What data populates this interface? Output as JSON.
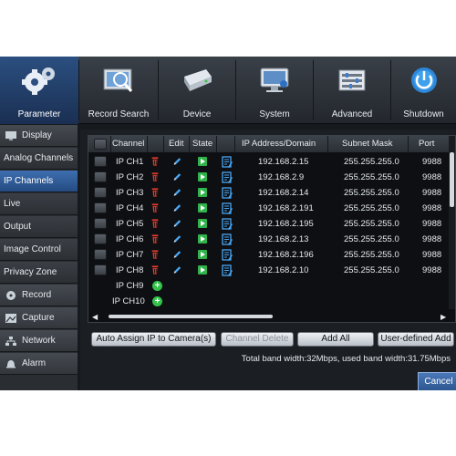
{
  "toolbar": {
    "items": [
      {
        "label": "Parameter",
        "icon": "gears-icon"
      },
      {
        "label": "Record Search",
        "icon": "record-search-icon"
      },
      {
        "label": "Device",
        "icon": "hard-disk-icon"
      },
      {
        "label": "System",
        "icon": "monitor-icon"
      },
      {
        "label": "Advanced",
        "icon": "advanced-icon"
      },
      {
        "label": "Shutdown",
        "icon": "power-icon"
      }
    ]
  },
  "sidebar": {
    "items": [
      {
        "label": "Display",
        "group": true
      },
      {
        "label": "Analog Channels",
        "group": false
      },
      {
        "label": "IP Channels",
        "group": false
      },
      {
        "label": "Live",
        "group": false
      },
      {
        "label": "Output",
        "group": false
      },
      {
        "label": "Image Control",
        "group": false
      },
      {
        "label": "Privacy Zone",
        "group": false
      },
      {
        "label": "Record",
        "group": true
      },
      {
        "label": "Capture",
        "group": true
      },
      {
        "label": "Network",
        "group": true
      },
      {
        "label": "Alarm",
        "group": true
      }
    ]
  },
  "table": {
    "headers": {
      "channel": "Channel",
      "edit": "Edit",
      "state": "State",
      "ip": "IP Address/Domain",
      "mask": "Subnet Mask",
      "port": "Port"
    },
    "rows": [
      {
        "channel": "IP CH1",
        "ip": "192.168.2.15",
        "mask": "255.255.255.0",
        "port": "9988"
      },
      {
        "channel": "IP CH2",
        "ip": "192.168.2.9",
        "mask": "255.255.255.0",
        "port": "9988"
      },
      {
        "channel": "IP CH3",
        "ip": "192.168.2.14",
        "mask": "255.255.255.0",
        "port": "9988"
      },
      {
        "channel": "IP CH4",
        "ip": "192.168.2.191",
        "mask": "255.255.255.0",
        "port": "9988"
      },
      {
        "channel": "IP CH5",
        "ip": "192.168.2.195",
        "mask": "255.255.255.0",
        "port": "9988"
      },
      {
        "channel": "IP CH6",
        "ip": "192.168.2.13",
        "mask": "255.255.255.0",
        "port": "9988"
      },
      {
        "channel": "IP CH7",
        "ip": "192.168.2.196",
        "mask": "255.255.255.0",
        "port": "9988"
      },
      {
        "channel": "IP CH8",
        "ip": "192.168.2.10",
        "mask": "255.255.255.0",
        "port": "9988"
      }
    ],
    "empty_rows": [
      {
        "channel": "IP CH9"
      },
      {
        "channel": "IP CH10"
      }
    ]
  },
  "buttons": {
    "auto_assign": "Auto Assign IP to Camera(s)",
    "channel_delete": "Channel Delete",
    "add_all": "Add All",
    "user_defined_add": "User-defined Add",
    "cancel": "Cancel"
  },
  "status": {
    "bandwidth": "Total band width:32Mbps, used band width:31.75Mbps"
  }
}
